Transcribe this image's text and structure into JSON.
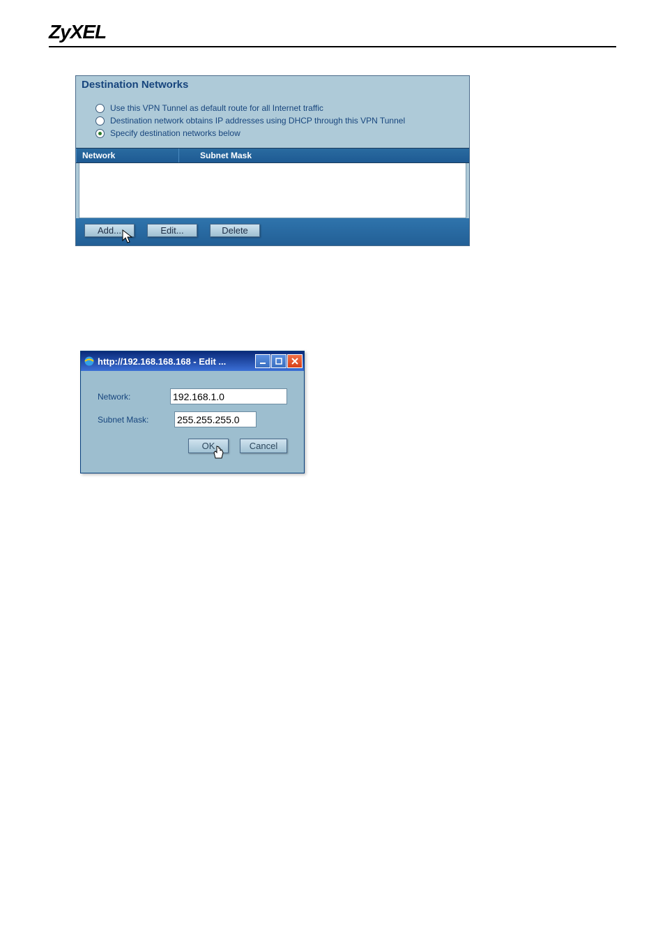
{
  "brand": "ZyXEL",
  "panel": {
    "title": "Destination Networks",
    "options": [
      {
        "label": "Use this VPN Tunnel as default route for all Internet traffic",
        "selected": false
      },
      {
        "label": "Destination network obtains IP addresses using DHCP through this VPN Tunnel",
        "selected": false
      },
      {
        "label": "Specify destination networks below",
        "selected": true
      }
    ],
    "columns": {
      "network": "Network",
      "subnet": "Subnet Mask"
    },
    "buttons": {
      "add": "Add...",
      "edit": "Edit...",
      "delete": "Delete"
    }
  },
  "popup": {
    "title_prefix": "http://192.168.168.168 - Edit ...",
    "fields": {
      "network_label": "Network:",
      "network_value": "192.168.1.0",
      "subnet_label": "Subnet Mask:",
      "subnet_value": "255.255.255.0"
    },
    "buttons": {
      "ok": "OK",
      "cancel": "Cancel"
    }
  }
}
